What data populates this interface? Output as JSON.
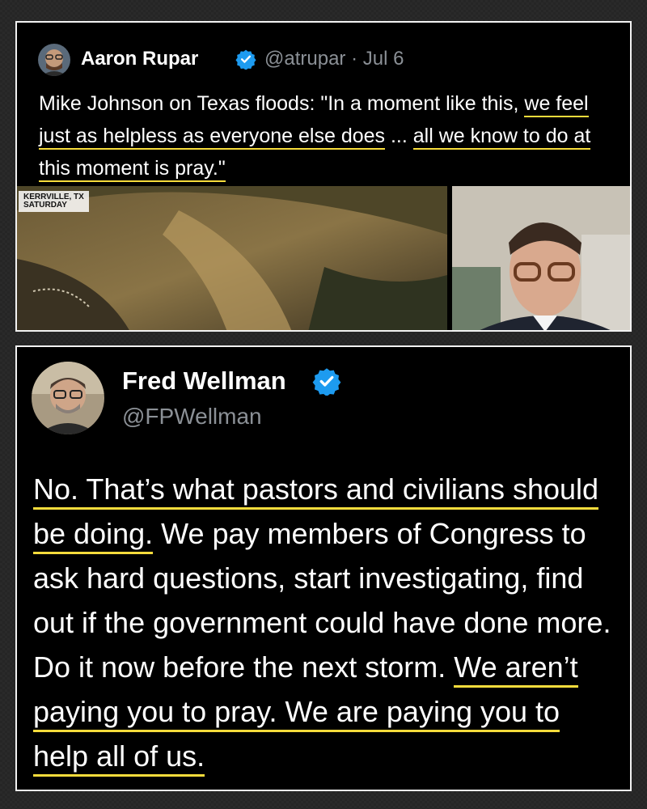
{
  "tweet1": {
    "author_name": "Aaron Rupar",
    "handle_date": "@atrupar · Jul 6",
    "text_a": "Mike Johnson on Texas floods: \"In a moment like this, ",
    "text_hl1": "we feel just as helpless as everyone else does",
    "text_b": " ... ",
    "text_hl2": "all we know to do at this moment is pray.\"",
    "chyron_line1": "KERRVILLE, TX",
    "chyron_line2": "SATURDAY"
  },
  "tweet2": {
    "author_name": "Fred Wellman",
    "handle": "@FPWellman",
    "text_hl1": "No. That’s what pastors and civilians should be doing.",
    "text_a": " We pay members of Congress to ask hard questions, start investigating, find out if the government could have done more.  Do it now before the next storm. ",
    "text_hl2": "We aren’t paying you to pray. We are paying you to help all of us."
  },
  "colors": {
    "background": "#000000",
    "verified": "#1d9bf0",
    "underline": "#f7dc3c",
    "handle": "#8b9096"
  },
  "icons": [
    "verified-badge-icon",
    "avatar-aaron-rupar",
    "avatar-fred-wellman"
  ]
}
